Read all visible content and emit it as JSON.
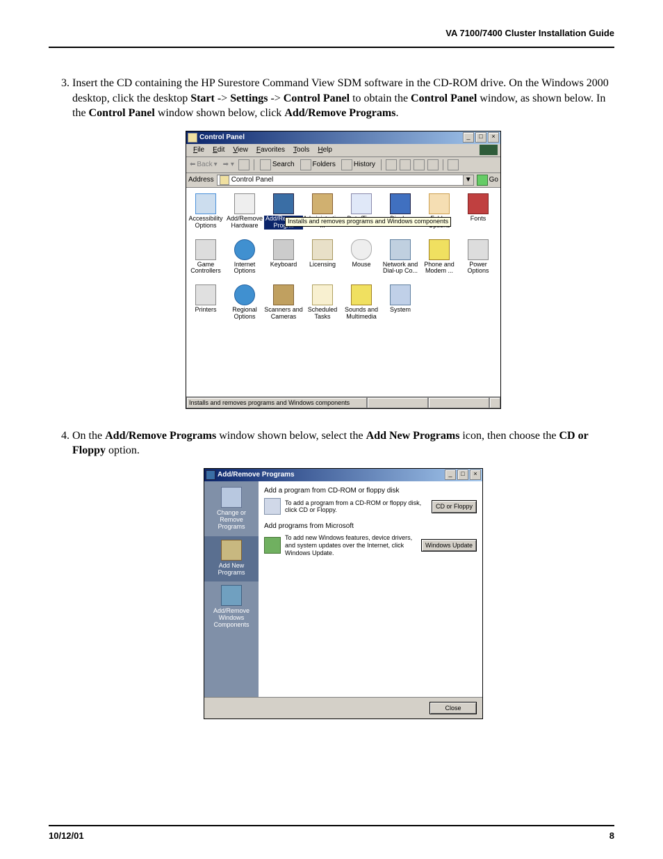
{
  "doc": {
    "header_title": "VA 7100/7400 Cluster Installation Guide",
    "footer_date": "10/12/01",
    "footer_page": "8"
  },
  "step3": {
    "num": "3.",
    "t1": "Insert the CD containing the HP Surestore Command View SDM software in the CD-ROM drive.  On the Windows 2000 desktop, click the desktop ",
    "b1": "Start",
    "t2": " -> ",
    "b2": "Settings",
    "t3": " -> ",
    "b3": "Control Panel",
    "t4": " to obtain the ",
    "b4": "Control Panel",
    "t5": " window, as shown below.  In the ",
    "b5": "Control Panel",
    "t6": " window shown below, click ",
    "b6": "Add/Remove Programs",
    "t7": "."
  },
  "step4": {
    "num": "4.",
    "t1": "On the ",
    "b1": "Add/Remove Programs",
    "t2": " window shown below, select the ",
    "b2": "Add New Programs",
    "t3": " icon, then choose the ",
    "b3": "CD or Floppy",
    "t4": " option."
  },
  "cp": {
    "title": "Control Panel",
    "menus": [
      "File",
      "Edit",
      "View",
      "Favorites",
      "Tools",
      "Help"
    ],
    "tb_back": "Back",
    "tb_search": "Search",
    "tb_folders": "Folders",
    "tb_history": "History",
    "addr_label": "Address",
    "addr_value": "Control Panel",
    "go": "Go",
    "items": {
      "r1": [
        "Accessibility Options",
        "Add/Remove Hardware",
        "Add/Remove Progr...",
        "Administrative ...",
        "Date/Time",
        "Display",
        "Folder Options",
        "Fonts"
      ],
      "r2": [
        "Game Controllers",
        "Internet Options",
        "Keyboard",
        "Licensing",
        "Mouse",
        "Network and Dial-up Co...",
        "Phone and Modem ...",
        "Power Options"
      ],
      "r3": [
        "Printers",
        "Regional Options",
        "Scanners and Cameras",
        "Scheduled Tasks",
        "Sounds and Multimedia",
        "System"
      ]
    },
    "tooltip": "Installs and removes programs and Windows components",
    "status": "Installs and removes programs and Windows components"
  },
  "arp": {
    "title": "Add/Remove Programs",
    "side": [
      "Change or Remove Programs",
      "Add New Programs",
      "Add/Remove Windows Components"
    ],
    "sect1": "Add a program from CD-ROM or floppy disk",
    "sect1_txt": "To add a program from a CD-ROM or floppy disk, click CD or Floppy.",
    "btn_cd": "CD or Floppy",
    "sect2": "Add programs from Microsoft",
    "sect2_txt": "To add new Windows features, device drivers, and system updates over the Internet, click Windows Update.",
    "btn_wu": "Windows Update",
    "close": "Close"
  }
}
